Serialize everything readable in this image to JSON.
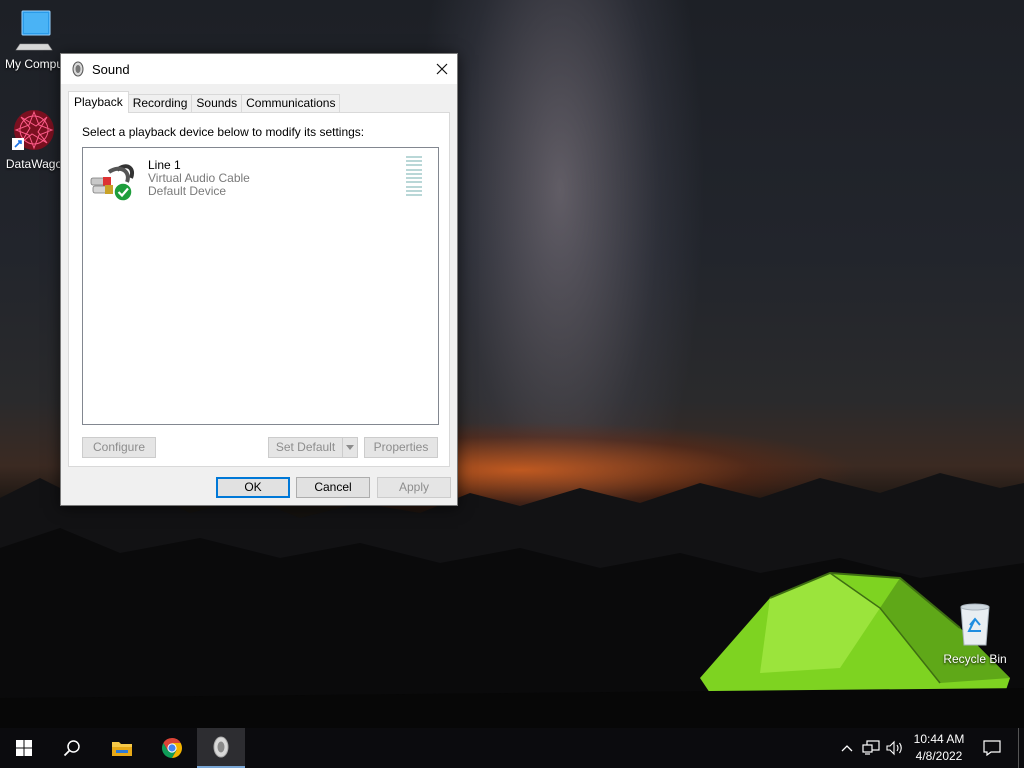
{
  "desktop": {
    "icons": [
      {
        "label": "My Compu"
      },
      {
        "label": "DataWago"
      },
      {
        "label": "Recycle Bin"
      }
    ]
  },
  "dialog": {
    "title": "Sound",
    "tabs": [
      {
        "label": "Playback"
      },
      {
        "label": "Recording"
      },
      {
        "label": "Sounds"
      },
      {
        "label": "Communications"
      }
    ],
    "instruction": "Select a playback device below to modify its settings:",
    "devices": [
      {
        "name": "Line 1",
        "subtitle": "Virtual Audio Cable",
        "status": "Default Device"
      }
    ],
    "buttons": {
      "configure": "Configure",
      "set_default": "Set Default",
      "properties": "Properties",
      "ok": "OK",
      "cancel": "Cancel",
      "apply": "Apply"
    }
  },
  "taskbar": {
    "clock_time": "10:44 AM",
    "clock_date": "4/8/2022",
    "pinned": [
      "start-icon",
      "search-icon",
      "file-explorer-icon",
      "chrome-icon",
      "sound-app-icon"
    ],
    "accent_color": "#0078d7"
  }
}
